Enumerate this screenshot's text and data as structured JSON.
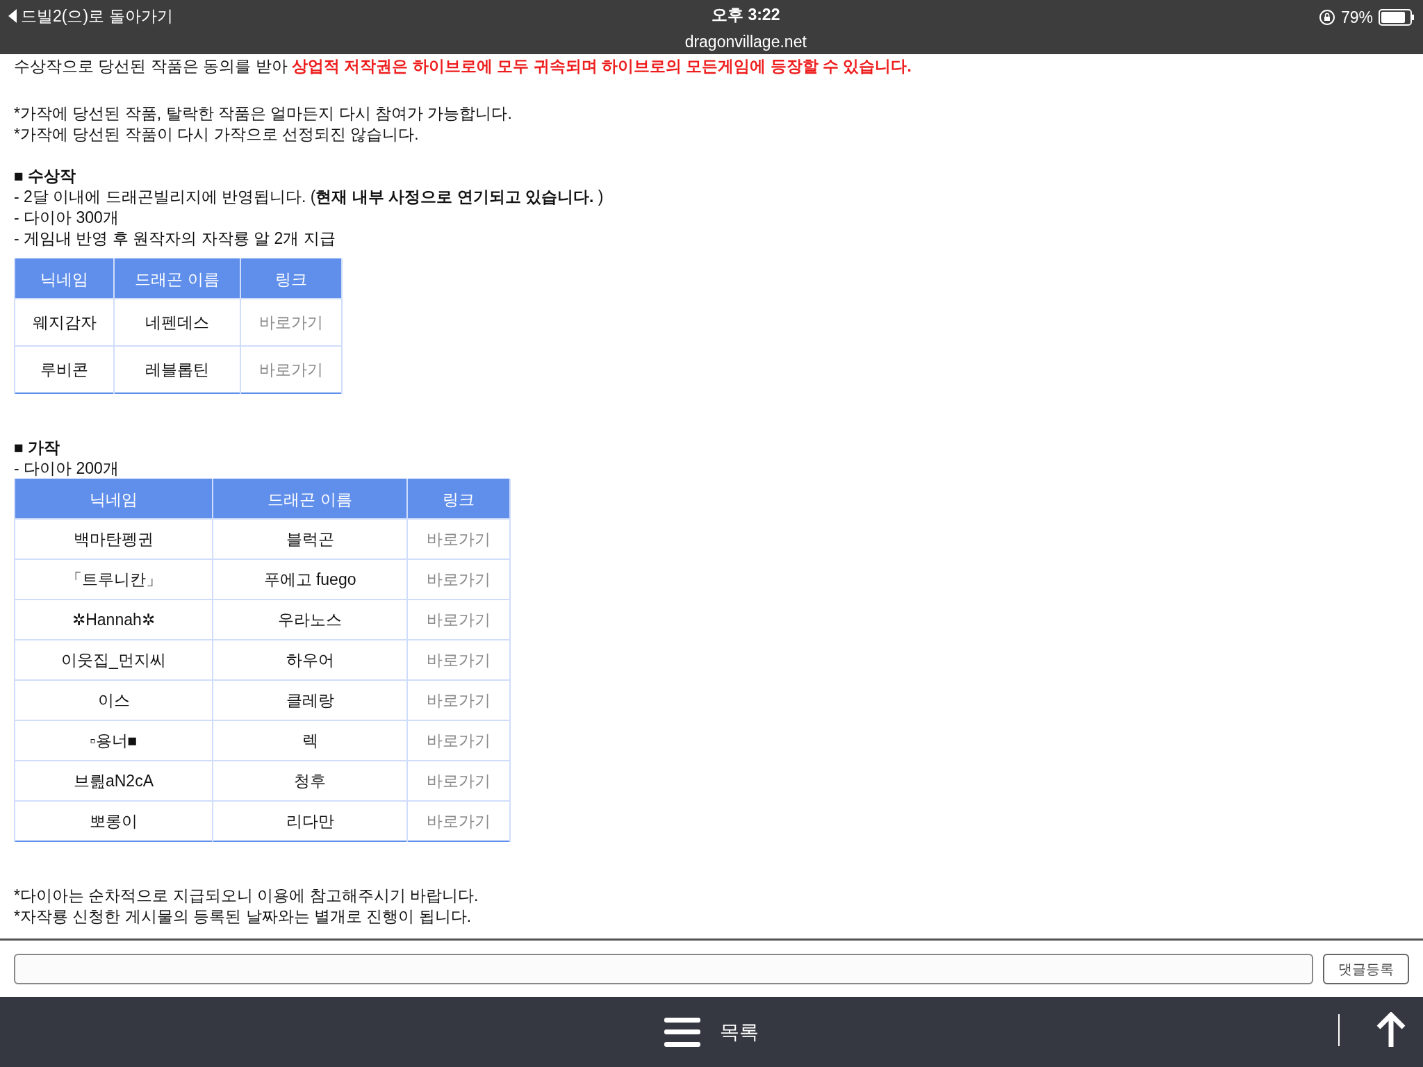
{
  "status_bar": {
    "back_label": "드빌2(으)로 돌아가기",
    "time": "오후 3:22",
    "url": "dragonvillage.net",
    "battery": "79%"
  },
  "content": {
    "intro_line": [
      {
        "kind": "plain",
        "text": "수상작으로 당선된 작품은 동의를 받아 "
      },
      {
        "kind": "alert",
        "text": "상업적 저작권은 하이브로에 모두 귀속되며 하이브로의 모든게임에 등장할 수 있습니다."
      }
    ],
    "notes_top": [
      "*가작에 당선된 작품, 탈락한 작품은 얼마든지 다시 참여가 가능합니다.",
      "*가작에 당선된 작품이 다시 가작으로 선정되진 않습니다."
    ],
    "sections": [
      {
        "heading": "■ 수상작",
        "lines": [
          "- 2달 이내에 드래곤빌리지에 반영됩니다. (**현재 내부 사정으로 연기되고 있습니다.** )",
          "- 다이아 300개",
          "- 게임내 반영 후 원작자의 자작룡 알 2개 지급"
        ],
        "table": {
          "columns": [
            "닉네임",
            "드래곤 이름",
            "링크"
          ],
          "rows": [
            {
              "nickname": "웨지감자",
              "dragon": "네펜데스",
              "link": "바로가기"
            },
            {
              "nickname": "루비콘",
              "dragon": "레블롭틴",
              "link": "바로가기"
            }
          ]
        }
      },
      {
        "heading": "■ 가작",
        "lines": [
          "- 다이아 200개"
        ],
        "table": {
          "columns": [
            "닉네임",
            "드래곤 이름",
            "링크"
          ],
          "rows": [
            {
              "nickname": "백마탄펭귄",
              "dragon": "블럭곤",
              "link": "바로가기"
            },
            {
              "nickname": "「트루니칸」",
              "dragon": "푸에고 fuego",
              "link": "바로가기"
            },
            {
              "nickname": "✲Hannah✲",
              "dragon": "우라노스",
              "link": "바로가기"
            },
            {
              "nickname": "이웃집_먼지씨",
              "dragon": "하우어",
              "link": "바로가기"
            },
            {
              "nickname": "이스",
              "dragon": "클레랑",
              "link": "바로가기"
            },
            {
              "nickname": "▫용너■",
              "dragon": "렉",
              "link": "바로가기"
            },
            {
              "nickname": "브릞aN2cA",
              "dragon": "청후",
              "link": "바로가기"
            },
            {
              "nickname": "뽀롱이",
              "dragon": "리다만",
              "link": "바로가기"
            }
          ]
        }
      }
    ],
    "notes_bottom": [
      "*다이아는 순차적으로 지급되오니 이용에 참고해주시기 바랍니다.",
      "*자작룡 신청한 게시물의 등록된 날짜와는 별개로 진행이 됩니다."
    ]
  },
  "comment_bar": {
    "submit_label": "댓글등록"
  },
  "bottom_nav": {
    "list_label": "목록"
  }
}
